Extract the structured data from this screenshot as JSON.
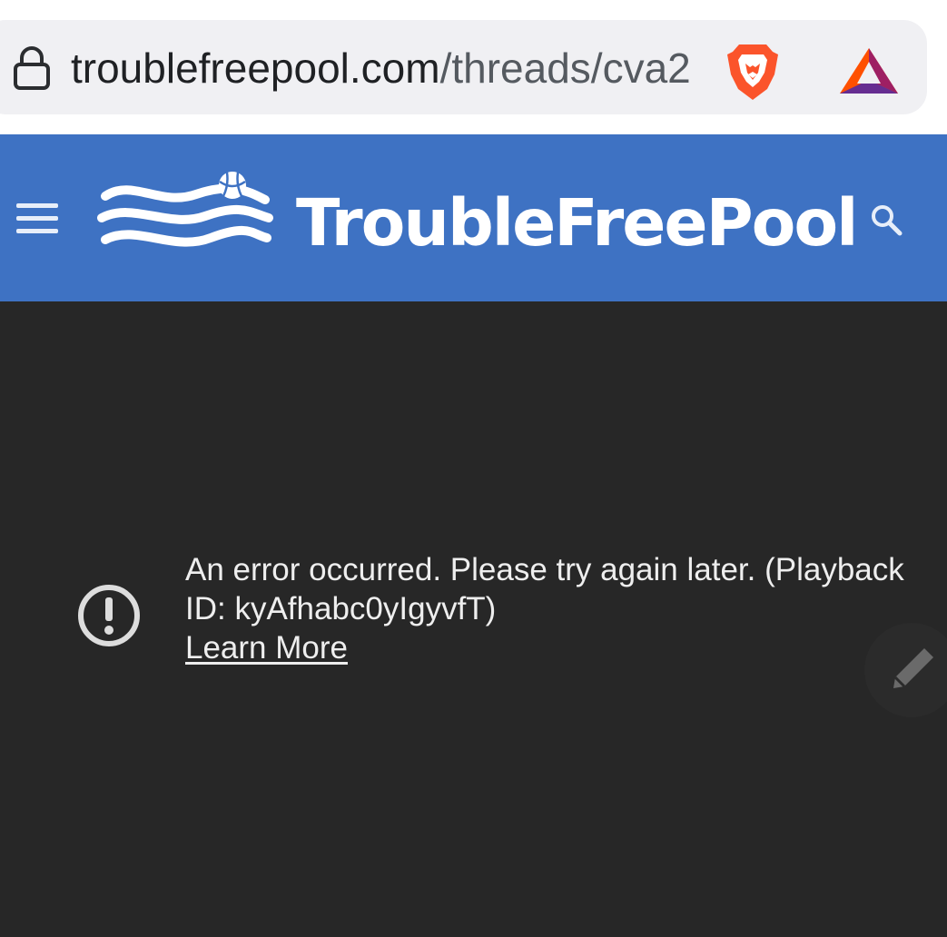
{
  "browser": {
    "url_domain": "troublefreepool.com",
    "url_path": "/threads/cva2",
    "icons": {
      "lock": "lock-icon",
      "brave": "brave-lion-icon",
      "bat": "bat-triangle-icon"
    }
  },
  "header": {
    "title": "TroubleFreePool",
    "background": "#3e72c3",
    "icons": {
      "menu": "hamburger-menu-icon",
      "logo": "waves-beach-ball-logo",
      "search": "search-icon"
    }
  },
  "player": {
    "background": "#272727",
    "error_text": "An error occurred. Please try again later. (Playback ID: kyAfhabc0yIgyvfT)",
    "learn_more": "Learn More",
    "icons": {
      "error": "alert-circle-icon",
      "edit": "pencil-icon"
    }
  }
}
